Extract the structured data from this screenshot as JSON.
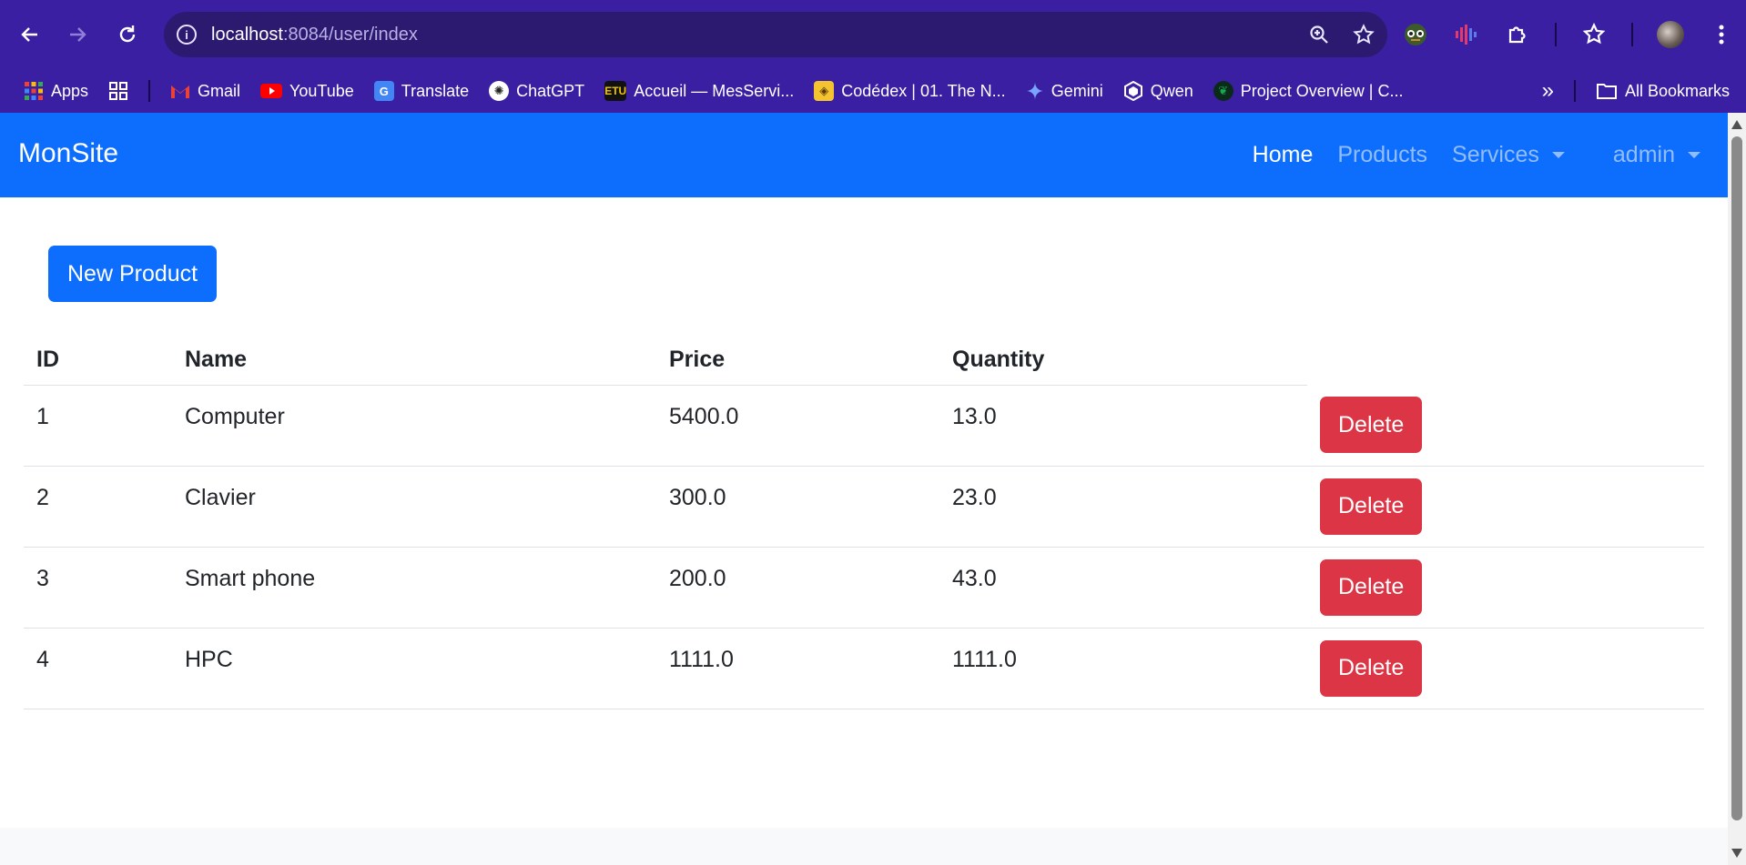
{
  "browser": {
    "url_host": "localhost",
    "url_path": ":8084/user/index",
    "bookmarks": [
      {
        "label": "Apps",
        "icon": "apps-grid-icon"
      },
      {
        "label": "Gmail",
        "icon": "gmail-icon"
      },
      {
        "label": "YouTube",
        "icon": "youtube-icon"
      },
      {
        "label": "Translate",
        "icon": "translate-icon"
      },
      {
        "label": "ChatGPT",
        "icon": "chatgpt-icon"
      },
      {
        "label": "Accueil — MesServi...",
        "icon": "etu-icon"
      },
      {
        "label": "Codédex | 01. The N...",
        "icon": "codedex-icon"
      },
      {
        "label": "Gemini",
        "icon": "gemini-icon"
      },
      {
        "label": "Qwen",
        "icon": "qwen-icon"
      },
      {
        "label": "Project Overview | C...",
        "icon": "mongodb-icon"
      }
    ],
    "all_bookmarks": "All Bookmarks",
    "more_chevron": "»"
  },
  "navbar": {
    "brand": "MonSite",
    "links": {
      "home": "Home",
      "products": "Products",
      "services": "Services",
      "user": "admin"
    }
  },
  "page": {
    "new_button": "New Product",
    "table": {
      "headers": [
        "ID",
        "Name",
        "Price",
        "Quantity"
      ],
      "delete_label": "Delete",
      "rows": [
        {
          "id": "1",
          "name": "Computer",
          "price": "5400.0",
          "quantity": "13.0"
        },
        {
          "id": "2",
          "name": "Clavier",
          "price": "300.0",
          "quantity": "23.0"
        },
        {
          "id": "3",
          "name": "Smart phone",
          "price": "200.0",
          "quantity": "43.0"
        },
        {
          "id": "4",
          "name": "HPC",
          "price": "1111.0",
          "quantity": "1111.0"
        }
      ]
    }
  },
  "colors": {
    "chrome": "#3a1fa3",
    "navbar": "#0d6efd",
    "primary_button": "#0d6efd",
    "danger_button": "#dc3545"
  }
}
